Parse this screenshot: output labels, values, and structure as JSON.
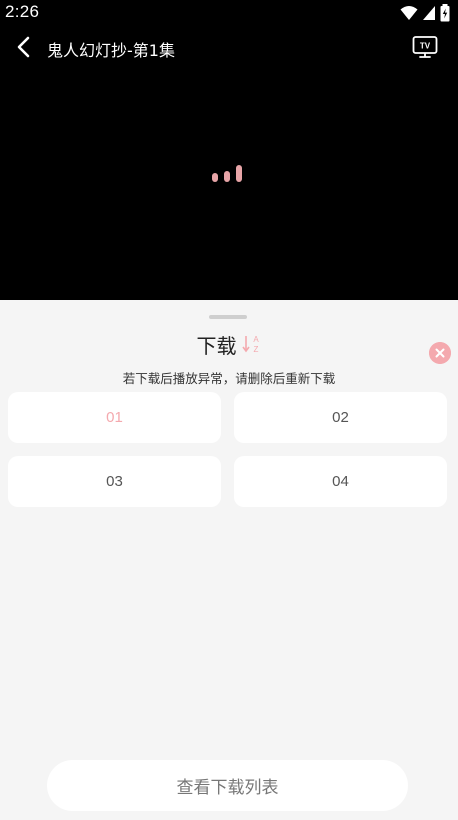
{
  "status_bar": {
    "time": "2:26",
    "icons": [
      "wifi-icon",
      "signal-icon",
      "battery-charging-icon"
    ]
  },
  "player": {
    "title": "鬼人幻灯抄-第1集",
    "back_icon": "chevron-left-icon",
    "tv_icon": "tv-cast-icon",
    "tv_label": "TV",
    "loading_icon": "loading-bars-icon"
  },
  "sheet": {
    "title": "下载",
    "sort_icon": "sort-az-icon",
    "sort_letters": [
      "A",
      "Z"
    ],
    "close_icon": "close-circle-icon",
    "notice": "若下载后播放异常，请删除后重新下载",
    "episodes": [
      {
        "label": "01",
        "active": true
      },
      {
        "label": "02",
        "active": false
      },
      {
        "label": "03",
        "active": false
      },
      {
        "label": "04",
        "active": false
      }
    ],
    "view_list_button": "查看下载列表"
  },
  "colors": {
    "accent": "#f4a9ae",
    "player_bg": "#000000",
    "sheet_bg": "#f5f5f5",
    "tile_bg": "#ffffff"
  }
}
